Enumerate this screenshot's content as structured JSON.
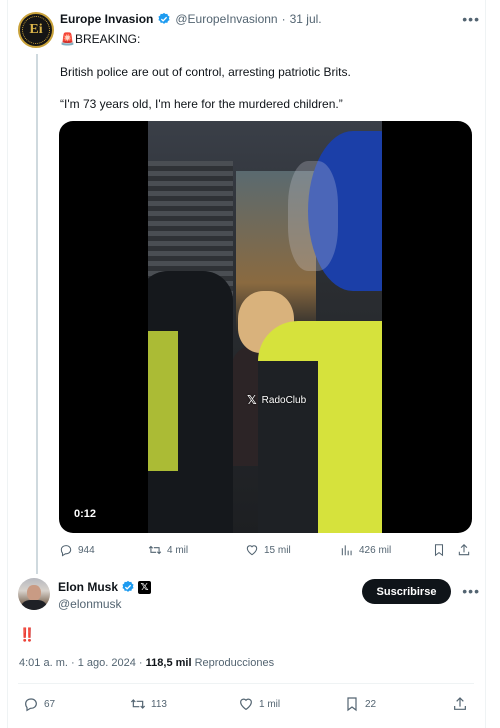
{
  "quoted_tweet": {
    "author_name": "Europe Invasion",
    "handle": "@EuropeInvasionn",
    "separator": "·",
    "date": "31 jul.",
    "avatar_text": "Ei",
    "breaking_emoji": "🚨",
    "breaking_label": "BREAKING:",
    "line1": "British police are out of control, arresting patriotic Brits.",
    "line2": "“I'm 73 years old, I'm here for the murdered children.”",
    "video": {
      "duration": "0:12",
      "watermark": "RadoClub"
    },
    "stats": {
      "replies": "944",
      "reposts": "4 mil",
      "likes": "15 mil",
      "views": "426 mil"
    }
  },
  "main_tweet": {
    "author_name": "Elon Musk",
    "handle": "@elonmusk",
    "subscribe_label": "Suscribirse",
    "text": "‼️",
    "time": "4:01 a. m.",
    "date": "1 ago. 2024",
    "meta_sep": "·",
    "views_count": "118,5 mil",
    "views_label": "Reproducciones",
    "stats": {
      "replies": "67",
      "reposts": "113",
      "likes": "1 mil",
      "bookmarks": "22"
    }
  },
  "colors": {
    "verified": "#1d9bf0",
    "muted": "#536471",
    "text": "#0f1419",
    "breaking_red": "#e0245e"
  },
  "icons": [
    "verified-icon",
    "more-icon",
    "reply-icon",
    "repost-icon",
    "like-icon",
    "views-icon",
    "bookmark-icon",
    "share-icon",
    "x-logo-icon"
  ]
}
